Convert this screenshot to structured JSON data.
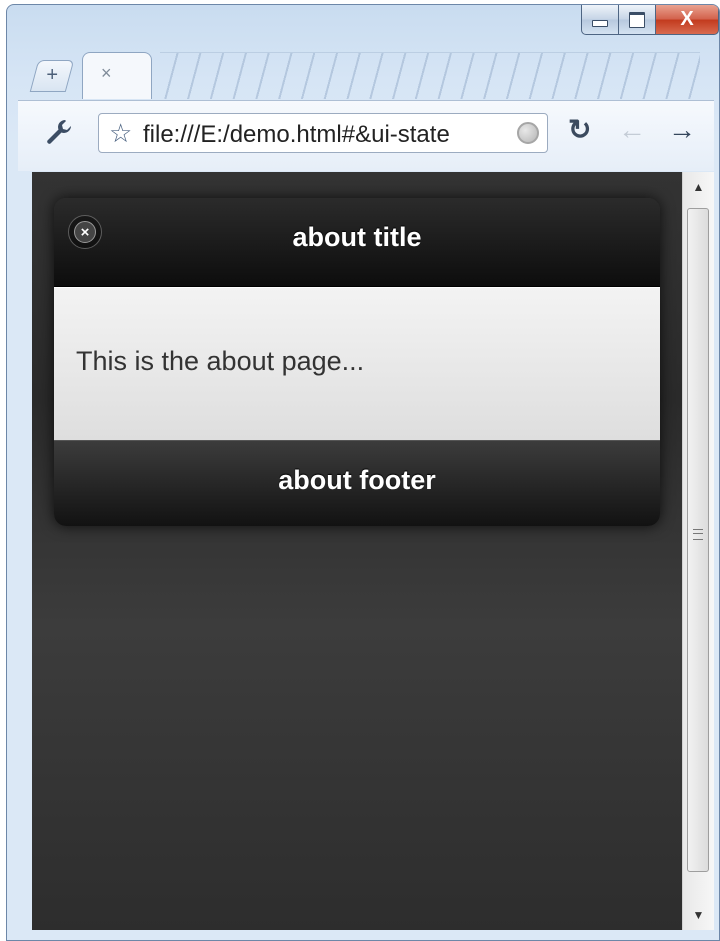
{
  "browser": {
    "new_tab_symbol": "+",
    "tab_close_symbol": "×",
    "url": "file:///E:/demo.html#&ui-state",
    "window_close_symbol": "X"
  },
  "dialog": {
    "title": "about title",
    "close_symbol": "×",
    "body_text": "This is the about page...",
    "footer_text": "about footer"
  },
  "icons": [
    "wrench-icon",
    "star-icon",
    "globe-icon",
    "reload-icon",
    "back-icon",
    "forward-icon"
  ]
}
